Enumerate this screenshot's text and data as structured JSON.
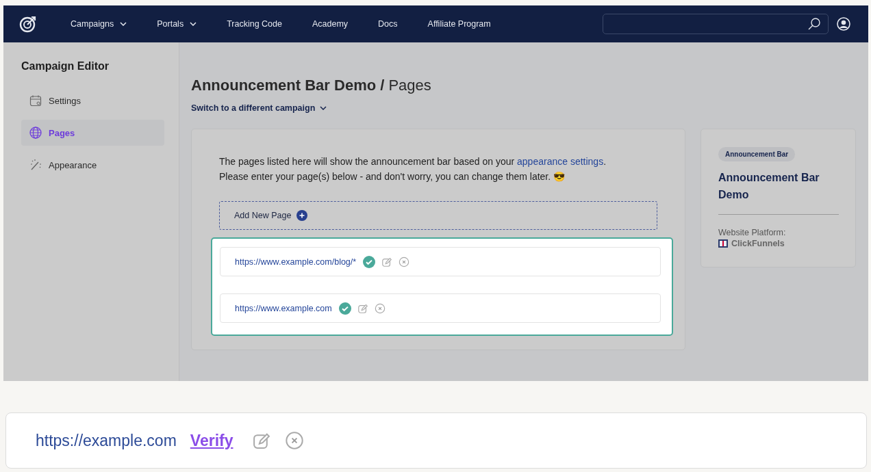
{
  "nav": {
    "items": [
      {
        "label": "Campaigns",
        "dropdown": true
      },
      {
        "label": "Portals",
        "dropdown": true
      },
      {
        "label": "Tracking Code",
        "dropdown": false
      },
      {
        "label": "Academy",
        "dropdown": false
      },
      {
        "label": "Docs",
        "dropdown": false
      },
      {
        "label": "Affiliate Program",
        "dropdown": false
      }
    ]
  },
  "sidebar": {
    "title": "Campaign Editor",
    "items": [
      {
        "label": "Settings",
        "kind": "calendar",
        "selected": false
      },
      {
        "label": "Pages",
        "kind": "globe",
        "selected": true
      },
      {
        "label": "Appearance",
        "kind": "wand",
        "selected": false
      }
    ]
  },
  "main": {
    "title": "Announcement Bar Demo /",
    "subtitle": "Pages",
    "switch_link": "Switch to a different campaign",
    "intro": {
      "before": "The pages listed here will show the announcement bar based on your ",
      "link": "appearance settings",
      "after": ".",
      "line2": "Please enter your page(s) below - and don't worry, you can change them later. 😎"
    },
    "add_button": "Add New Page",
    "pages": [
      {
        "url": "https://www.example.com/blog/*",
        "verified": true
      },
      {
        "url": "https://www.example.com",
        "verified": true
      }
    ]
  },
  "info_card": {
    "tag": "Announcement Bar",
    "name": "Announcement Bar Demo",
    "platform_label": "Website Platform:",
    "platform": "ClickFunnels"
  },
  "callout": {
    "url": "https://example.com",
    "verify_link": "Verify",
    "verified": false
  }
}
